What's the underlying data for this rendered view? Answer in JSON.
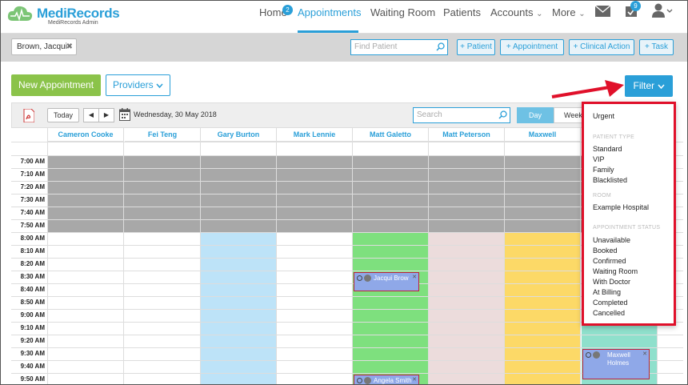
{
  "brand": {
    "name": "MediRecords",
    "subtitle": "MediRecords Admin"
  },
  "nav": {
    "items": [
      {
        "label": "Home",
        "badge": "2"
      },
      {
        "label": "Appointments"
      },
      {
        "label": "Waiting Room"
      },
      {
        "label": "Patients"
      },
      {
        "label": "Accounts",
        "caret": "⌄"
      },
      {
        "label": "More",
        "caret": "⌄"
      }
    ],
    "tasks_badge": "9",
    "icons": [
      "mail-icon",
      "tasks-icon",
      "user-icon"
    ]
  },
  "actionbar": {
    "patient_tag": "Brown, Jacqui",
    "patient_tag_close": "✖",
    "find_placeholder": "Find Patient",
    "buttons": [
      "+ Patient",
      "+ Appointment",
      "+ Clinical Action",
      "+ Task"
    ]
  },
  "toolbar": {
    "new_appointment": "New Appointment",
    "providers": "Providers",
    "filter": "Filter"
  },
  "calendar": {
    "today": "Today",
    "prev": "◀",
    "next": "▶",
    "date": "Wednesday, 30 May 2018",
    "search_placeholder": "Search",
    "view_day": "Day",
    "view_week": "Week",
    "providers": [
      "Cameron Cooke",
      "Fei Teng",
      "Gary Burton",
      "Mark Lennie",
      "Matt Galetto",
      "Matt Peterson",
      "Maxwell",
      ""
    ],
    "times": [
      "7:00 AM",
      "7:10 AM",
      "7:20 AM",
      "7:30 AM",
      "7:40 AM",
      "7:50 AM",
      "8:00 AM",
      "8:10 AM",
      "8:20 AM",
      "8:30 AM",
      "8:40 AM",
      "8:50 AM",
      "9:00 AM",
      "9:10 AM",
      "9:20 AM",
      "9:30 AM",
      "9:40 AM",
      "9:50 AM"
    ],
    "appointments": [
      {
        "patient": "Jacqui Brow",
        "provider": "Matt Galetto",
        "time": "8:30 AM"
      },
      {
        "patient": "Maxwell Holmes",
        "provider": "",
        "time": "9:30 AM"
      },
      {
        "patient": "Angela Smith",
        "provider": "Matt Galetto",
        "time": "9:50 AM"
      }
    ],
    "colors": {
      "blocked": "#a8a8a8",
      "blue": "#bde3f8",
      "green": "#7ee07e",
      "pink": "#ecdcdc",
      "yellow": "#fcd967",
      "teal": "#8fe0cc"
    }
  },
  "filter_menu": {
    "urgent": "Urgent",
    "patient_type_header": "PATIENT TYPE",
    "patient_types": [
      "Standard",
      "VIP",
      "Family",
      "Blacklisted"
    ],
    "room_header": "ROOM",
    "rooms": [
      "Example Hospital"
    ],
    "status_header": "APPOINTMENT STATUS",
    "statuses": [
      "Unavailable",
      "Booked",
      "Confirmed",
      "Waiting Room",
      "With Doctor",
      "At Billing",
      "Completed",
      "Cancelled"
    ]
  }
}
